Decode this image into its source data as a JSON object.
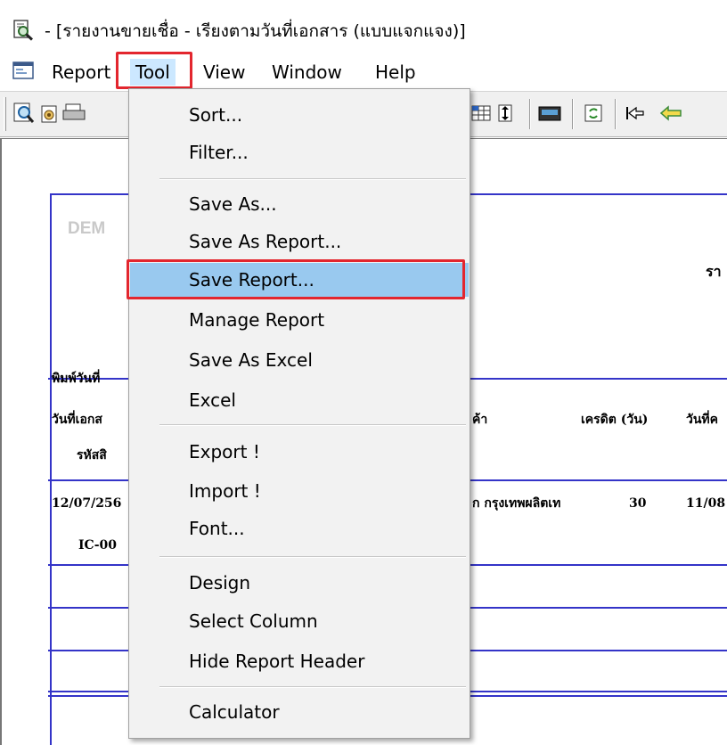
{
  "window": {
    "title": "- [รายงานขายเชื่อ - เรียงตามวันที่เอกสาร (แบบแจกแจง)]",
    "icon": "magnifier-document-icon"
  },
  "menubar": {
    "items": [
      {
        "label": "Report"
      },
      {
        "label": "Tool"
      },
      {
        "label": "View"
      },
      {
        "label": "Window"
      },
      {
        "label": "Help"
      }
    ],
    "active_item": "Tool",
    "highlight_color": "#e3262e"
  },
  "tool_menu": {
    "items": [
      {
        "label": "Sort..."
      },
      {
        "label": "Filter..."
      },
      {
        "label": "Save As..."
      },
      {
        "label": "Save As Report..."
      },
      {
        "label": "Save Report..."
      },
      {
        "label": "Manage Report"
      },
      {
        "label": "Save As Excel"
      },
      {
        "label": "Excel"
      },
      {
        "label": "Export !"
      },
      {
        "label": "Import !"
      },
      {
        "label": "Font..."
      },
      {
        "label": "Design"
      },
      {
        "label": "Select Column"
      },
      {
        "label": "Hide Report Header"
      },
      {
        "label": "Calculator"
      }
    ],
    "selected_item": "Save Report...",
    "selected_color": "#99c9ef"
  },
  "report": {
    "company": "DEM",
    "title_fragment": "รา",
    "print_date_label": "พิมพ์วันที่",
    "headers": {
      "doc_date": "วันที่เอกส",
      "customer": "ค้า",
      "credit_days": "เครดิต (วัน)",
      "due_date": "วันที่ค",
      "product_code": "รหัสสิ"
    },
    "rows": [
      {
        "doc_date": "12/07/256",
        "customer": "ก กรุงเทพผลิตเท",
        "credit_days": "30",
        "due_date": "11/08",
        "product_code": "IC-00"
      }
    ],
    "line_color": "#3434c8"
  }
}
